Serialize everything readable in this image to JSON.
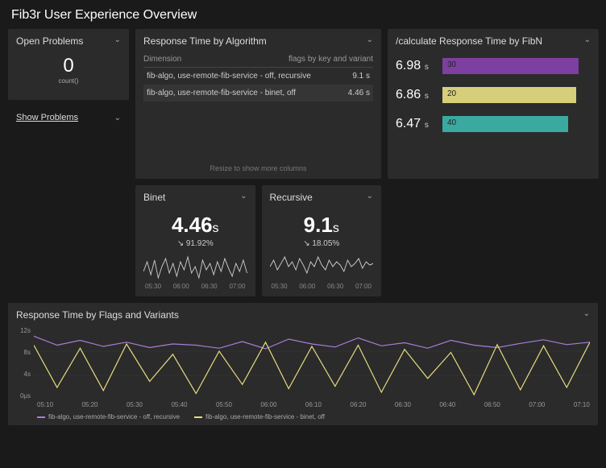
{
  "page_title": "Fib3r User Experience Overview",
  "open_problems": {
    "title": "Open Problems",
    "value": "0",
    "label": "count()"
  },
  "show_problems_link": "Show Problems",
  "rt_algo": {
    "title": "Response Time by Algorithm",
    "col1": "Dimension",
    "col2": "flags by key and variant",
    "rows": [
      {
        "dim": "fib-algo, use-remote-fib-service - off, recursive",
        "val": "9.1 s"
      },
      {
        "dim": "fib-algo, use-remote-fib-service - binet, off",
        "val": "4.46 s"
      }
    ],
    "resize_hint": "Resize to show more columns"
  },
  "fibn": {
    "title": "/calculate Response Time by FibN",
    "rows": [
      {
        "value": "6.98",
        "unit": "s",
        "label": "30",
        "pct": 92,
        "color": "#7d3fa0"
      },
      {
        "value": "6.86",
        "unit": "s",
        "label": "20",
        "pct": 90,
        "color": "#d6ce7a"
      },
      {
        "value": "6.47",
        "unit": "s",
        "label": "40",
        "pct": 85,
        "color": "#3aa9a0"
      }
    ]
  },
  "metrics": {
    "binet": {
      "title": "Binet",
      "value": "4.46",
      "unit": "s",
      "delta": "↘ 91.92%",
      "ticks": [
        "05:30",
        "06:00",
        "06:30",
        "07:00"
      ]
    },
    "recursive": {
      "title": "Recursive",
      "value": "9.1",
      "unit": "s",
      "delta": "↘ 18.05%",
      "ticks": [
        "05:30",
        "06:00",
        "06:30",
        "07:00"
      ]
    }
  },
  "big_chart_title": "Response Time by Flags and Variants",
  "legend": [
    {
      "label": "fib-algo, use-remote-fib-service - off, recursive",
      "color": "#a97dd6"
    },
    {
      "label": "fib-algo, use-remote-fib-service - binet, off",
      "color": "#e8dc7f"
    }
  ],
  "chart_data": {
    "type": "line",
    "title": "Response Time by Flags and Variants",
    "ylabel": "s",
    "ylim": [
      0,
      12
    ],
    "yticks": [
      "12s",
      "8s",
      "4s",
      "0μs"
    ],
    "xticks": [
      "05:10",
      "05:20",
      "05:30",
      "05:40",
      "05:50",
      "06:00",
      "06:10",
      "06:20",
      "06:30",
      "06:40",
      "06:50",
      "07:00",
      "07:10"
    ],
    "x": [
      "05:10",
      "05:15",
      "05:20",
      "05:25",
      "05:30",
      "05:35",
      "05:40",
      "05:45",
      "05:50",
      "05:55",
      "06:00",
      "06:05",
      "06:10",
      "06:15",
      "06:20",
      "06:25",
      "06:30",
      "06:35",
      "06:40",
      "06:45",
      "06:50",
      "06:55",
      "07:00",
      "07:05",
      "07:10"
    ],
    "series": [
      {
        "name": "fib-algo, use-remote-fib-service - off, recursive",
        "color": "#a97dd6",
        "values": [
          10.5,
          9.0,
          9.8,
          8.8,
          9.5,
          8.6,
          9.2,
          9.0,
          8.5,
          9.6,
          8.4,
          10.0,
          9.2,
          8.7,
          10.2,
          8.9,
          9.4,
          8.5,
          9.8,
          9.0,
          8.6,
          9.3,
          9.9,
          9.1,
          9.5
        ]
      },
      {
        "name": "fib-algo, use-remote-fib-service - binet, off",
        "color": "#e8dc7f",
        "values": [
          9.0,
          2.0,
          8.5,
          1.5,
          9.2,
          3.0,
          7.5,
          1.0,
          8.0,
          2.5,
          9.5,
          1.8,
          8.8,
          2.2,
          9.0,
          1.2,
          8.3,
          3.5,
          7.8,
          0.8,
          9.1,
          1.6,
          8.9,
          2.0,
          9.5
        ]
      }
    ],
    "small_charts": [
      {
        "name": "Binet",
        "type": "line",
        "values": [
          4,
          6,
          3,
          7,
          2,
          5,
          8,
          3,
          6,
          2,
          7,
          4,
          9,
          3,
          5,
          2,
          8,
          4,
          6,
          3
        ],
        "ticks": [
          "05:30",
          "06:00",
          "06:30",
          "07:00"
        ]
      },
      {
        "name": "Recursive",
        "type": "line",
        "values": [
          6,
          9,
          5,
          7,
          10,
          6,
          8,
          5,
          9,
          7,
          4,
          8,
          6,
          10,
          7,
          5,
          9,
          6,
          8,
          7
        ],
        "ticks": [
          "05:30",
          "06:00",
          "06:30",
          "07:00"
        ]
      }
    ]
  }
}
